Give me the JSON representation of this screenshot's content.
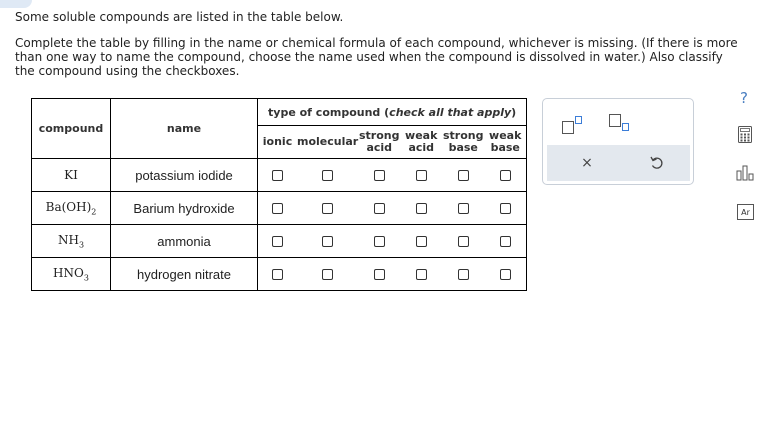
{
  "intro_text": "Some soluble compounds are listed in the table below.",
  "instructions_text": "Complete the table by filling in the name or chemical formula of each compound, whichever is missing. (If there is more than one way to name the compound, choose the name used when the compound is dissolved in water.) Also classify the compound using the checkboxes.",
  "table": {
    "col_compound": "compound",
    "col_name": "name",
    "type_header_prefix": "type of compound (",
    "type_header_em": "check all that apply",
    "type_header_suffix": ")",
    "types": [
      {
        "line1": "ionic",
        "line2": ""
      },
      {
        "line1": "molecular",
        "line2": ""
      },
      {
        "line1": "strong",
        "line2": "acid"
      },
      {
        "line1": "weak",
        "line2": "acid"
      },
      {
        "line1": "strong",
        "line2": "base"
      },
      {
        "line1": "weak",
        "line2": "base"
      }
    ],
    "rows": [
      {
        "formula_main": "KI",
        "formula_sub": "",
        "formula_tail": "",
        "name": "potassium iodide"
      },
      {
        "formula_main": "Ba(OH)",
        "formula_sub": "2",
        "formula_tail": "",
        "name": "Barium hydroxide"
      },
      {
        "formula_main": "NH",
        "formula_sub": "3",
        "formula_tail": "",
        "name": "ammonia"
      },
      {
        "formula_main": "HNO",
        "formula_sub": "3",
        "formula_tail": "",
        "name": "hydrogen nitrate"
      }
    ]
  },
  "panel": {
    "clear_symbol": "×"
  },
  "sidebar": {
    "help_symbol": "?",
    "periodic_label": "Ar"
  },
  "colors": {
    "accent": "#3b7dd8",
    "panel_bg": "#e3e8ee",
    "help": "#4a7fc1"
  }
}
